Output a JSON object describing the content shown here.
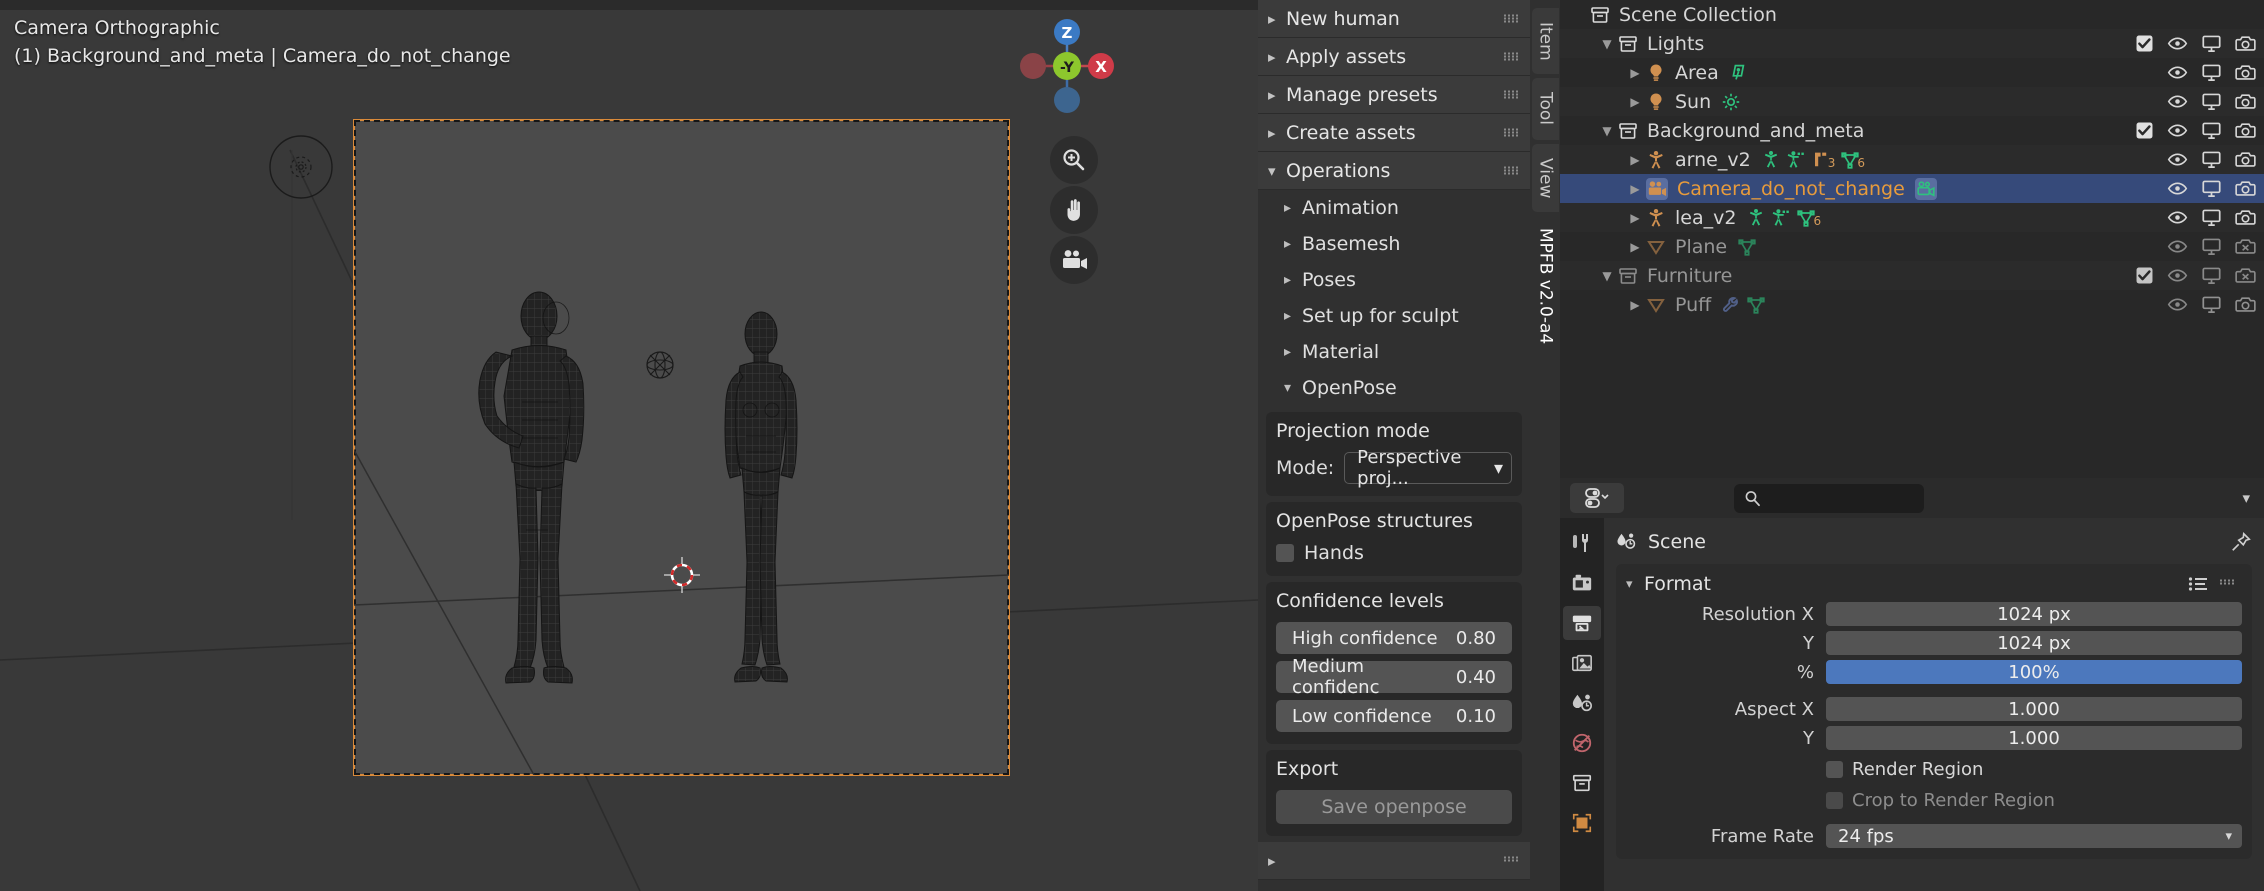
{
  "viewport": {
    "line1": "Camera Orthographic",
    "line2": "(1) Background_and_meta | Camera_do_not_change",
    "gizmo": {
      "z": "Z",
      "y": "-Y",
      "x": "X"
    },
    "buttons": [
      {
        "name": "zoom-icon",
        "label": "zoom"
      },
      {
        "name": "hand-icon",
        "label": "pan"
      },
      {
        "name": "camera-icon",
        "label": "camera-view"
      }
    ]
  },
  "sidebar": {
    "tabs": [
      {
        "label": "Item",
        "active": false
      },
      {
        "label": "Tool",
        "active": false
      },
      {
        "label": "View",
        "active": false
      },
      {
        "label": "MPFB v2.0-a4",
        "active": true
      }
    ],
    "panels": [
      {
        "label": "New human",
        "expanded": false
      },
      {
        "label": "Apply assets",
        "expanded": false
      },
      {
        "label": "Manage presets",
        "expanded": false
      },
      {
        "label": "Create assets",
        "expanded": false
      },
      {
        "label": "Operations",
        "expanded": true
      }
    ],
    "operations_children": [
      {
        "label": "Animation",
        "expanded": false
      },
      {
        "label": "Basemesh",
        "expanded": false
      },
      {
        "label": "Poses",
        "expanded": false
      },
      {
        "label": "Set up for sculpt",
        "expanded": false
      },
      {
        "label": "Material",
        "expanded": false
      },
      {
        "label": "OpenPose",
        "expanded": true
      }
    ],
    "projection": {
      "title": "Projection mode",
      "mode_label": "Mode:",
      "mode_value": "Perspective proj..."
    },
    "structures": {
      "title": "OpenPose structures",
      "hands_label": "Hands",
      "hands_checked": false
    },
    "confidence": {
      "title": "Confidence levels",
      "items": [
        {
          "label": "High confidence",
          "value": "0.80"
        },
        {
          "label": "Medium confidenc",
          "value": "0.40"
        },
        {
          "label": "Low confidence",
          "value": "0.10"
        }
      ]
    },
    "export": {
      "title": "Export",
      "button_label": "Save openpose",
      "button_enabled": false
    }
  },
  "outliner": {
    "rows": [
      {
        "name": "Scene Collection",
        "indent": 0,
        "icon": "collection-icon",
        "disclosure": "",
        "selected": false,
        "dim": false,
        "checkbox": false,
        "restrict": null,
        "extra": []
      },
      {
        "name": "Lights",
        "indent": 1,
        "icon": "collection-icon",
        "disclosure": "down",
        "selected": false,
        "dim": false,
        "checkbox": true,
        "restrict": {
          "eye": true,
          "screen": true,
          "camera": true
        },
        "extra": []
      },
      {
        "name": "Area",
        "indent": 2,
        "icon": "light-icon",
        "disclosure": "right",
        "selected": false,
        "dim": false,
        "checkbox": false,
        "restrict": {
          "eye": true,
          "screen": true,
          "camera": true
        },
        "extra": [
          {
            "icon": "area-light-data-icon",
            "count": ""
          }
        ]
      },
      {
        "name": "Sun",
        "indent": 2,
        "icon": "light-icon",
        "disclosure": "right",
        "selected": false,
        "dim": false,
        "checkbox": false,
        "restrict": {
          "eye": true,
          "screen": true,
          "camera": true
        },
        "extra": [
          {
            "icon": "sun-light-data-icon",
            "count": ""
          }
        ]
      },
      {
        "name": "Background_and_meta",
        "indent": 1,
        "icon": "collection-icon",
        "disclosure": "down",
        "selected": false,
        "dim": false,
        "checkbox": true,
        "restrict": {
          "eye": true,
          "screen": true,
          "camera": true
        },
        "extra": []
      },
      {
        "name": "arne_v2",
        "indent": 2,
        "icon": "armature-icon",
        "disclosure": "right",
        "selected": false,
        "dim": false,
        "checkbox": false,
        "restrict": {
          "eye": true,
          "screen": true,
          "camera": true
        },
        "extra": [
          {
            "icon": "armature-data-icon",
            "count": ""
          },
          {
            "icon": "pose-icon",
            "count": ""
          },
          {
            "icon": "modifier-icon",
            "count": "3"
          },
          {
            "icon": "mesh-data-icon",
            "count": "6"
          }
        ]
      },
      {
        "name": "Camera_do_not_change",
        "indent": 2,
        "icon": "camera-obj-icon",
        "disclosure": "right",
        "selected": true,
        "dim": false,
        "checkbox": false,
        "restrict": {
          "eye": true,
          "screen": true,
          "camera": true
        },
        "extra": [
          {
            "icon": "camera-data-icon",
            "count": ""
          }
        ]
      },
      {
        "name": "lea_v2",
        "indent": 2,
        "icon": "armature-icon",
        "disclosure": "right",
        "selected": false,
        "dim": false,
        "checkbox": false,
        "restrict": {
          "eye": true,
          "screen": true,
          "camera": true
        },
        "extra": [
          {
            "icon": "armature-data-icon",
            "count": ""
          },
          {
            "icon": "pose-icon",
            "count": ""
          },
          {
            "icon": "mesh-data-icon",
            "count": "6"
          }
        ]
      },
      {
        "name": "Plane",
        "indent": 2,
        "icon": "mesh-icon",
        "disclosure": "right",
        "selected": false,
        "dim": true,
        "checkbox": false,
        "restrict": {
          "eye": true,
          "screen": false,
          "camera": "disabled"
        },
        "extra": [
          {
            "icon": "mesh-data-icon",
            "count": ""
          }
        ]
      },
      {
        "name": "Furniture",
        "indent": 1,
        "icon": "collection-icon",
        "disclosure": "down",
        "selected": false,
        "dim": true,
        "checkbox": true,
        "restrict": {
          "eye": true,
          "screen": false,
          "camera": "disabled"
        },
        "extra": []
      },
      {
        "name": "Puff",
        "indent": 2,
        "icon": "mesh-icon",
        "disclosure": "right",
        "selected": false,
        "dim": true,
        "checkbox": false,
        "restrict": {
          "eye": true,
          "screen": true,
          "camera": true
        },
        "extra": [
          {
            "icon": "modifier-wrench-icon",
            "count": ""
          },
          {
            "icon": "mesh-data-icon",
            "count": ""
          }
        ]
      }
    ]
  },
  "properties": {
    "search_placeholder": "",
    "breadcrumb": "Scene",
    "tabs": [
      {
        "name": "tool-tab",
        "active": false
      },
      {
        "name": "render-tab",
        "active": false
      },
      {
        "name": "output-tab",
        "active": true
      },
      {
        "name": "view-layer-tab",
        "active": false
      },
      {
        "name": "scene-tab",
        "active": false
      },
      {
        "name": "world-tab",
        "active": false
      },
      {
        "name": "collection-tab",
        "active": false
      },
      {
        "name": "object-tab",
        "active": false
      }
    ],
    "format": {
      "title": "Format",
      "fields": [
        {
          "label": "Resolution X",
          "value": "1024 px",
          "accent": false,
          "type": "number"
        },
        {
          "label": "Y",
          "value": "1024 px",
          "accent": false,
          "type": "number"
        },
        {
          "label": "%",
          "value": "100%",
          "accent": true,
          "type": "number"
        },
        {
          "label": "Aspect X",
          "value": "1.000",
          "accent": false,
          "type": "number"
        },
        {
          "label": "Y",
          "value": "1.000",
          "accent": false,
          "type": "number"
        }
      ],
      "checkboxes": [
        {
          "label": "Render Region",
          "checked": false,
          "enabled": true
        },
        {
          "label": "Crop to Render Region",
          "checked": false,
          "enabled": false
        }
      ],
      "frame_rate_label": "Frame Rate",
      "frame_rate_value": "24 fps"
    }
  },
  "colors": {
    "accent_blue": "#4c78bd",
    "selection_row": "#364a7a",
    "selected_text": "#e79b3c",
    "camera_frame": "#d98a3a",
    "green_data": "#2ec27e",
    "orange_obj": "#d09050"
  }
}
